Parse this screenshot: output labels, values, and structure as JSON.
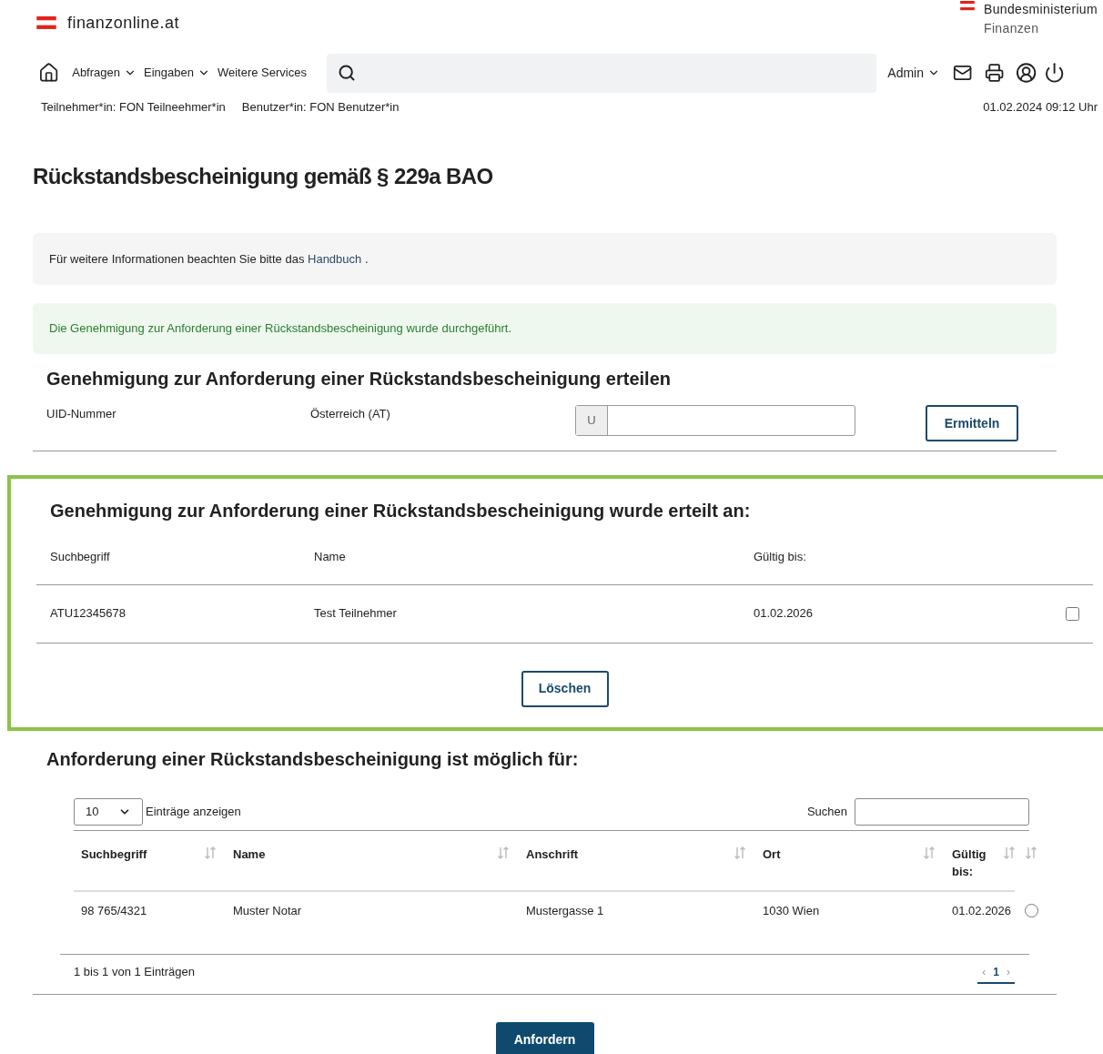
{
  "header": {
    "logo_text": "finanzonline.at",
    "ministry": [
      "Bundesministerium",
      "Finanzen"
    ]
  },
  "nav": {
    "items": [
      {
        "label": "Abfragen",
        "dropdown": true
      },
      {
        "label": "Eingaben",
        "dropdown": true
      },
      {
        "label": "Weitere Services",
        "dropdown": false
      }
    ],
    "admin": {
      "label": "Admin",
      "dropdown": true
    }
  },
  "session": {
    "participant": "Teilnehmer*in: FON Teilneehmer*in",
    "user": "Benutzer*in: FON Benutzer*in",
    "datetime": "01.02.2024 09:12 Uhr"
  },
  "title": "Rückstandsbescheinigung gemäß § 229a BAO",
  "info_box": {
    "text": "Für weitere Informationen beachten Sie bitte das",
    "link": "Handbuch",
    "after": "."
  },
  "success_message": "Die Genehmigung zur Anforderung einer Rückstandsbescheinigung wurde durchgeführt.",
  "grant_section": {
    "heading": "Genehmigung zur Anforderung einer Rückstandsbescheinigung erteilen",
    "uid_label": "UID-Nummer",
    "country": "Österreich (AT)",
    "prefix": "U",
    "button": "Ermitteln"
  },
  "granted_section": {
    "heading": "Genehmigung zur Anforderung einer Rückstandsbescheinigung wurde erteilt an:",
    "highlighted": true,
    "columns": [
      "Suchbegriff",
      "Name",
      "Gültig bis:"
    ],
    "rows": [
      {
        "cells": [
          "ATU12345678",
          "Test Teilnehmer",
          "01.02.2026"
        ],
        "checked": false
      }
    ],
    "button": "Löschen"
  },
  "possible_section": {
    "heading": "Anforderung einer Rückstandsbescheinigung ist möglich für:",
    "page_length": "10",
    "length_label": "Einträge anzeigen",
    "search_label": "Suchen",
    "columns": [
      {
        "label": "Suchbegriff",
        "sortable": true
      },
      {
        "label": "Name",
        "sortable": true
      },
      {
        "label": "Anschrift",
        "sortable": true
      },
      {
        "label": "Ort",
        "sortable": true
      },
      {
        "label": "Gültig bis:",
        "sortable": true
      }
    ],
    "select_column_sortable": true,
    "rows": [
      {
        "cells": [
          "98 765/4321",
          "Muster Notar",
          "Mustergasse 1",
          "1030 Wien",
          "01.02.2026"
        ],
        "selected": false
      }
    ],
    "info": "1 bis 1 von 1 Einträgen",
    "pagination": {
      "prev": "‹",
      "pages": [
        {
          "label": "1",
          "selected": true
        }
      ],
      "next": "›"
    },
    "button": "Anfordern"
  }
}
